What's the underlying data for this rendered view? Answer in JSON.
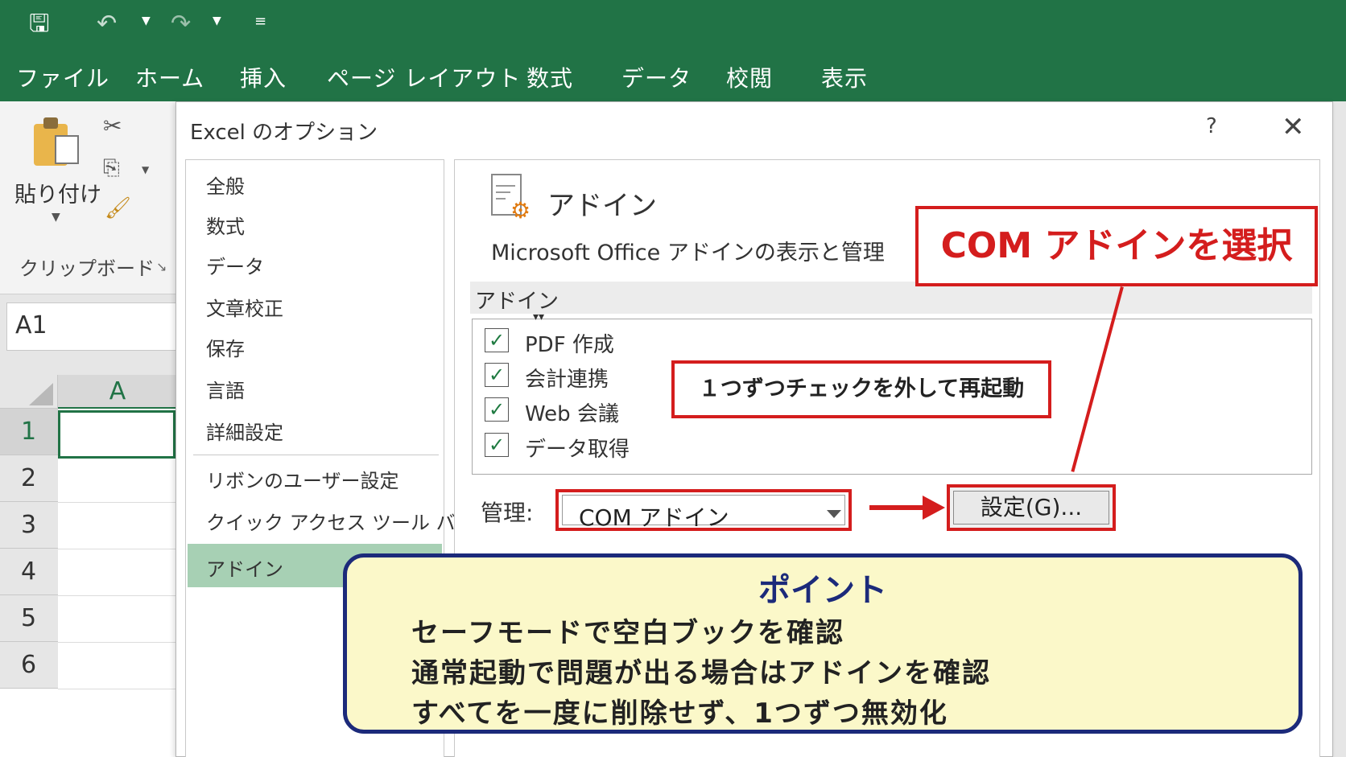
{
  "qat": {
    "save_icon": "save-icon",
    "undo_icon": "undo-icon",
    "redo_icon": "redo-icon",
    "customize_icon": "customize-qat-icon"
  },
  "ribbon_tabs": [
    "ファイル",
    "ホーム",
    "挿入",
    "ページ レイアウト",
    "数式",
    "データ",
    "校閲",
    "表示"
  ],
  "clipboard": {
    "paste_label": "貼り付け",
    "group_label": "クリップボード"
  },
  "namebox": {
    "value": "A1"
  },
  "sheet": {
    "column": "A",
    "rows": [
      "1",
      "2",
      "3",
      "4",
      "5",
      "6"
    ],
    "selected_cell": "A1"
  },
  "dialog": {
    "title": "Excel のオプション",
    "help": "?",
    "close": "✕",
    "nav": [
      "全般",
      "数式",
      "データ",
      "文章校正",
      "保存",
      "言語",
      "詳細設定",
      "リボンのユーザー設定",
      "クイック アクセス ツール バー",
      "アドイン"
    ],
    "active_nav": "アドイン",
    "heading": "アドイン",
    "subheading": "Microsoft Office アドインの表示と管理",
    "section": "アドイン",
    "addins": [
      "PDF 作成",
      "会計連携",
      "Web 会議",
      "データ取得"
    ],
    "manage_label": "管理:",
    "manage_value": "COM アドイン",
    "go_button": "設定(G)..."
  },
  "callouts": {
    "com_select": "COM アドインを選択",
    "uncheck_restart": "１つずつチェックを外して再起動"
  },
  "point": {
    "title": "ポイント",
    "lines": [
      "セーフモードで空白ブックを確認",
      "通常起動で問題が出る場合はアドインを確認",
      "すべてを一度に削除せず、1つずつ無効化"
    ]
  },
  "colors": {
    "excel_green": "#217346",
    "annotation_red": "#d41d1d",
    "point_border": "#1c2a7a",
    "point_fill": "#fbf8c9",
    "nav_active": "#a7d0b4"
  }
}
